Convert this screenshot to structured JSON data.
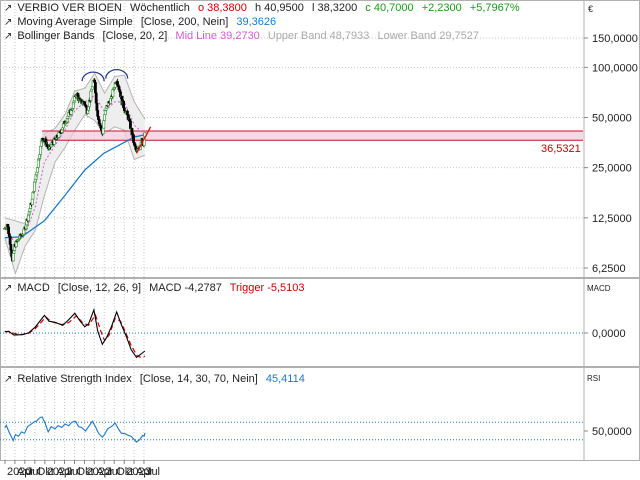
{
  "colors": {
    "candle_up": "#2a8a2a",
    "candle_down": "#000000",
    "sma": "#1e78c8",
    "bb_mid": "#d060d0",
    "bb_band": "#b4b4b4",
    "bb_fill": "#eeeeee",
    "zone_fill": "#f4c7d8",
    "zone_line": "#c8102e",
    "trend_line": "#e01010",
    "macd": "#000000",
    "trigger": "#cc0000",
    "rsi": "#1e78c8",
    "ref": "#1e78c8",
    "grid": "#c8c8c8",
    "label_red": "#cc0000",
    "label_green": "#1a9a1a",
    "label_blue": "#1e78c8",
    "label_gray": "#aaaaaa",
    "label_pink": "#d060d0"
  },
  "price_panel": {
    "legend": {
      "name": "VERBIO VER BIOEN",
      "period": "Wöchentlich",
      "open": "o 38,3800",
      "high": "h 40,9500",
      "low": "l 38,3200",
      "close": "c 40,7000",
      "change": "+2,2300",
      "change_pct": "+5,7967%"
    },
    "sma_legend": {
      "label": "Moving Average Simple",
      "params": "[Close, 200, Nein]",
      "value": "39,3626"
    },
    "bb_legend": {
      "label": "Bollinger Bands",
      "params": "[Close, 20, 2]",
      "mid": "Mid Line 39,2730",
      "upper": "Upper Band 48,7933",
      "lower": "Lower Band 29,7527"
    },
    "scale_symbol": "€",
    "y_ticks": [
      "150,0000",
      "100,0000",
      "50,0000",
      "25,0000",
      "12,5000",
      "6,2500"
    ],
    "level_label": "36,5321"
  },
  "macd_panel": {
    "legend": {
      "label": "MACD",
      "params": "[Close, 12, 26, 9]",
      "macd": "MACD -4,2787",
      "trigger": "Trigger -5,5103"
    },
    "scale_label": "MACD",
    "y_ticks": [
      "0,0000"
    ]
  },
  "rsi_panel": {
    "legend": {
      "label": "Relative Strength Index",
      "params": "[Close, 14, 30, 70, Nein]",
      "value": "45,4114"
    },
    "scale_label": "RSI",
    "y_ticks": [
      "50,0000"
    ]
  },
  "x_axis": {
    "labels": [
      "2020",
      "Apr",
      "Jul",
      "Okt",
      "2021",
      "Apr",
      "Jul",
      "Okt",
      "2022",
      "Apr",
      "Jul",
      "Okt",
      "2023",
      "Apr",
      "Jul"
    ]
  },
  "chart_data": [
    {
      "type": "candlestick",
      "title": "VERBIO VER BIOEN Wöchentlich",
      "scale": "log",
      "ylim": [
        5.5,
        200
      ],
      "x_range": [
        "2020-01-01",
        "2023-09-01"
      ],
      "anchors": [
        [
          "2019-12-30",
          10.8
        ],
        [
          "2020-01-20",
          11.5
        ],
        [
          "2020-02-17",
          9.0
        ],
        [
          "2020-03-09",
          6.8
        ],
        [
          "2020-03-30",
          8.5
        ],
        [
          "2020-05-04",
          9.3
        ],
        [
          "2020-06-22",
          10.3
        ],
        [
          "2020-07-27",
          12.5
        ],
        [
          "2020-09-07",
          16
        ],
        [
          "2020-10-19",
          24
        ],
        [
          "2020-11-23",
          33
        ],
        [
          "2020-12-07",
          38
        ],
        [
          "2021-01-04",
          36
        ],
        [
          "2021-02-08",
          32
        ],
        [
          "2021-03-08",
          35
        ],
        [
          "2021-04-12",
          37
        ],
        [
          "2021-05-17",
          40
        ],
        [
          "2021-06-21",
          45
        ],
        [
          "2021-07-26",
          50
        ],
        [
          "2021-08-30",
          55
        ],
        [
          "2021-09-20",
          60
        ],
        [
          "2021-10-18",
          70
        ],
        [
          "2021-11-22",
          62
        ],
        [
          "2021-12-27",
          62
        ],
        [
          "2022-01-24",
          55
        ],
        [
          "2022-02-21",
          65
        ],
        [
          "2022-03-21",
          82
        ],
        [
          "2022-04-04",
          80
        ],
        [
          "2022-04-25",
          55
        ],
        [
          "2022-05-23",
          45
        ],
        [
          "2022-06-13",
          40
        ],
        [
          "2022-07-04",
          52
        ],
        [
          "2022-08-01",
          60
        ],
        [
          "2022-09-05",
          65
        ],
        [
          "2022-10-03",
          78
        ],
        [
          "2022-10-24",
          85
        ],
        [
          "2022-11-14",
          75
        ],
        [
          "2022-12-12",
          62
        ],
        [
          "2023-01-09",
          55
        ],
        [
          "2023-02-06",
          50
        ],
        [
          "2023-03-06",
          42
        ],
        [
          "2023-04-03",
          34
        ],
        [
          "2023-04-24",
          31
        ],
        [
          "2023-05-22",
          33
        ],
        [
          "2023-06-12",
          38
        ],
        [
          "2023-06-26",
          35
        ],
        [
          "2023-07-10",
          40.7
        ]
      ],
      "last_bar": {
        "open": 38.38,
        "high": 40.95,
        "low": 38.32,
        "close": 40.7
      },
      "overlays": [
        {
          "name": "Moving Average Simple",
          "params": "Close, 200",
          "values": [
            [
              "2019-12-30",
              9.5
            ],
            [
              "2020-06-01",
              9.6
            ],
            [
              "2020-12-28",
              12.0
            ],
            [
              "2021-06-28",
              16.8
            ],
            [
              "2022-01-03",
              24.2
            ],
            [
              "2022-06-27",
              30.5
            ],
            [
              "2023-01-02",
              35.5
            ],
            [
              "2023-04-03",
              38.2
            ],
            [
              "2023-07-10",
              39.36
            ]
          ]
        },
        {
          "name": "Bollinger Bands Mid Line",
          "params": "Close, 20, 2",
          "values": [
            [
              "2019-12-30",
              10.8
            ],
            [
              "2020-04-06",
              8.8
            ],
            [
              "2020-07-06",
              10.0
            ],
            [
              "2020-10-05",
              14.5
            ],
            [
              "2020-12-28",
              27
            ],
            [
              "2021-04-05",
              34
            ],
            [
              "2021-07-05",
              42
            ],
            [
              "2021-10-04",
              55
            ],
            [
              "2022-01-03",
              62
            ],
            [
              "2022-04-04",
              68
            ],
            [
              "2022-07-04",
              54
            ],
            [
              "2022-10-03",
              62
            ],
            [
              "2023-01-02",
              62
            ],
            [
              "2023-04-03",
              45
            ],
            [
              "2023-07-10",
              39.27
            ]
          ]
        },
        {
          "name": "Upper Band",
          "values": [
            [
              "2019-12-30",
              12.5
            ],
            [
              "2020-04-06",
              12
            ],
            [
              "2020-07-06",
              11.5
            ],
            [
              "2020-10-05",
              19
            ],
            [
              "2020-12-28",
              40
            ],
            [
              "2021-04-05",
              43
            ],
            [
              "2021-07-05",
              52
            ],
            [
              "2021-10-04",
              72
            ],
            [
              "2022-01-03",
              75
            ],
            [
              "2022-04-04",
              92
            ],
            [
              "2022-07-04",
              70
            ],
            [
              "2022-10-03",
              88
            ],
            [
              "2023-01-02",
              90
            ],
            [
              "2023-04-03",
              62
            ],
            [
              "2023-07-10",
              48.79
            ]
          ]
        },
        {
          "name": "Lower Band",
          "values": [
            [
              "2019-12-30",
              9.5
            ],
            [
              "2020-04-06",
              5.8
            ],
            [
              "2020-07-06",
              8.5
            ],
            [
              "2020-10-05",
              10.5
            ],
            [
              "2020-12-28",
              17
            ],
            [
              "2021-04-05",
              27
            ],
            [
              "2021-07-05",
              33
            ],
            [
              "2021-10-04",
              42
            ],
            [
              "2022-01-03",
              52
            ],
            [
              "2022-04-04",
              48
            ],
            [
              "2022-07-04",
              40
            ],
            [
              "2022-10-03",
              44
            ],
            [
              "2023-01-02",
              42
            ],
            [
              "2023-04-03",
              28
            ],
            [
              "2023-07-10",
              29.75
            ]
          ]
        }
      ],
      "annotations": {
        "zone": [
          36.5321,
          41.5
        ],
        "zone_from": "2020-12-07",
        "level": 36.5321,
        "trend_line": [
          [
            "2023-04-24",
            30.5
          ],
          [
            "2023-09-01",
            44
          ]
        ],
        "tops": [
          [
            "2022-03-21",
            85
          ],
          [
            "2022-10-24",
            88
          ]
        ]
      }
    },
    {
      "type": "line",
      "title": "MACD [Close, 12, 26, 9]",
      "ylim": [
        -8,
        12
      ],
      "series": [
        {
          "name": "MACD",
          "values": [
            [
              "2019-12-30",
              0.3
            ],
            [
              "2020-02-03",
              0.4
            ],
            [
              "2020-03-23",
              -0.5
            ],
            [
              "2020-06-01",
              -0.4
            ],
            [
              "2020-08-03",
              0.0
            ],
            [
              "2020-10-05",
              1.4
            ],
            [
              "2020-12-28",
              4.2
            ],
            [
              "2021-02-08",
              2.8
            ],
            [
              "2021-04-12",
              2.5
            ],
            [
              "2021-06-14",
              1.8
            ],
            [
              "2021-08-02",
              3.0
            ],
            [
              "2021-10-04",
              4.7
            ],
            [
              "2021-11-22",
              2.8
            ],
            [
              "2022-01-03",
              1.5
            ],
            [
              "2022-02-07",
              2.2
            ],
            [
              "2022-03-28",
              5.5
            ],
            [
              "2022-05-02",
              0.5
            ],
            [
              "2022-06-13",
              -2.7
            ],
            [
              "2022-07-25",
              -1.0
            ],
            [
              "2022-09-05",
              1.5
            ],
            [
              "2022-10-24",
              5.0
            ],
            [
              "2022-12-05",
              2.0
            ],
            [
              "2023-01-23",
              -1.0
            ],
            [
              "2023-03-06",
              -4.0
            ],
            [
              "2023-04-24",
              -5.8
            ],
            [
              "2023-06-05",
              -5.0
            ],
            [
              "2023-07-10",
              -4.28
            ]
          ]
        },
        {
          "name": "Trigger",
          "values": [
            [
              "2019-12-30",
              0.3
            ],
            [
              "2020-02-03",
              0.35
            ],
            [
              "2020-04-06",
              -0.2
            ],
            [
              "2020-06-08",
              -0.4
            ],
            [
              "2020-08-03",
              -0.1
            ],
            [
              "2020-10-05",
              1.0
            ],
            [
              "2021-01-11",
              3.8
            ],
            [
              "2021-03-01",
              2.7
            ],
            [
              "2021-06-07",
              2.0
            ],
            [
              "2021-08-09",
              2.5
            ],
            [
              "2021-10-18",
              4.1
            ],
            [
              "2021-12-13",
              2.5
            ],
            [
              "2022-02-07",
              1.8
            ],
            [
              "2022-04-11",
              4.3
            ],
            [
              "2022-05-30",
              0.5
            ],
            [
              "2022-07-04",
              -1.8
            ],
            [
              "2022-08-15",
              -0.5
            ],
            [
              "2022-10-10",
              3.5
            ],
            [
              "2022-11-28",
              2.8
            ],
            [
              "2023-01-16",
              0.0
            ],
            [
              "2023-03-06",
              -3.0
            ],
            [
              "2023-05-01",
              -5.5
            ],
            [
              "2023-06-05",
              -5.8
            ],
            [
              "2023-07-10",
              -5.51
            ]
          ]
        }
      ],
      "reference_line": 0
    },
    {
      "type": "line",
      "title": "Relative Strength Index [Close, 14, 30, 70, Nein]",
      "ylim": [
        15,
        90
      ],
      "series": [
        {
          "name": "Relative Strength Index",
          "values": [
            [
              "2019-12-30",
              57
            ],
            [
              "2020-01-13",
              63
            ],
            [
              "2020-02-03",
              50
            ],
            [
              "2020-03-02",
              36
            ],
            [
              "2020-03-16",
              28
            ],
            [
              "2020-04-06",
              42
            ],
            [
              "2020-05-04",
              38
            ],
            [
              "2020-06-01",
              48
            ],
            [
              "2020-06-29",
              45
            ],
            [
              "2020-07-27",
              60
            ],
            [
              "2020-08-24",
              65
            ],
            [
              "2020-09-21",
              70
            ],
            [
              "2020-10-19",
              73
            ],
            [
              "2020-11-16",
              80
            ],
            [
              "2020-12-07",
              82
            ],
            [
              "2021-01-04",
              68
            ],
            [
              "2021-02-01",
              48
            ],
            [
              "2021-03-01",
              60
            ],
            [
              "2021-04-05",
              55
            ],
            [
              "2021-05-03",
              62
            ],
            [
              "2021-06-07",
              58
            ],
            [
              "2021-07-05",
              66
            ],
            [
              "2021-08-09",
              62
            ],
            [
              "2021-09-06",
              70
            ],
            [
              "2021-10-11",
              72
            ],
            [
              "2021-11-08",
              60
            ],
            [
              "2021-12-06",
              58
            ],
            [
              "2022-01-10",
              50
            ],
            [
              "2022-02-07",
              60
            ],
            [
              "2022-03-14",
              72
            ],
            [
              "2022-04-11",
              60
            ],
            [
              "2022-05-09",
              45
            ],
            [
              "2022-06-13",
              36
            ],
            [
              "2022-07-04",
              42
            ],
            [
              "2022-08-01",
              55
            ],
            [
              "2022-09-05",
              60
            ],
            [
              "2022-10-10",
              68
            ],
            [
              "2022-11-07",
              55
            ],
            [
              "2022-12-05",
              45
            ],
            [
              "2023-01-09",
              44
            ],
            [
              "2023-02-06",
              40
            ],
            [
              "2023-03-06",
              38
            ],
            [
              "2023-04-03",
              30
            ],
            [
              "2023-04-24",
              25
            ],
            [
              "2023-05-22",
              30
            ],
            [
              "2023-06-19",
              40
            ],
            [
              "2023-07-03",
              38
            ],
            [
              "2023-07-10",
              45.41
            ]
          ]
        }
      ],
      "reference_lines": [
        30,
        70
      ]
    }
  ]
}
